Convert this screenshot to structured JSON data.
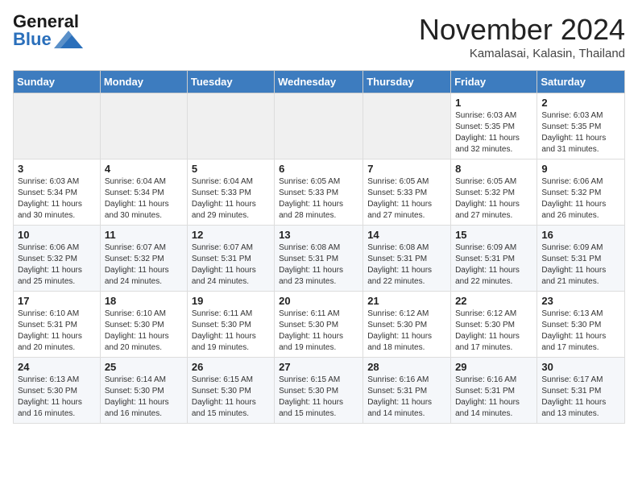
{
  "header": {
    "logo_general": "General",
    "logo_blue": "Blue",
    "month_title": "November 2024",
    "location": "Kamalasai, Kalasin, Thailand"
  },
  "days_of_week": [
    "Sunday",
    "Monday",
    "Tuesday",
    "Wednesday",
    "Thursday",
    "Friday",
    "Saturday"
  ],
  "weeks": [
    [
      {
        "day": "",
        "info": ""
      },
      {
        "day": "",
        "info": ""
      },
      {
        "day": "",
        "info": ""
      },
      {
        "day": "",
        "info": ""
      },
      {
        "day": "",
        "info": ""
      },
      {
        "day": "1",
        "info": "Sunrise: 6:03 AM\nSunset: 5:35 PM\nDaylight: 11 hours and 32 minutes."
      },
      {
        "day": "2",
        "info": "Sunrise: 6:03 AM\nSunset: 5:35 PM\nDaylight: 11 hours and 31 minutes."
      }
    ],
    [
      {
        "day": "3",
        "info": "Sunrise: 6:03 AM\nSunset: 5:34 PM\nDaylight: 11 hours and 30 minutes."
      },
      {
        "day": "4",
        "info": "Sunrise: 6:04 AM\nSunset: 5:34 PM\nDaylight: 11 hours and 30 minutes."
      },
      {
        "day": "5",
        "info": "Sunrise: 6:04 AM\nSunset: 5:33 PM\nDaylight: 11 hours and 29 minutes."
      },
      {
        "day": "6",
        "info": "Sunrise: 6:05 AM\nSunset: 5:33 PM\nDaylight: 11 hours and 28 minutes."
      },
      {
        "day": "7",
        "info": "Sunrise: 6:05 AM\nSunset: 5:33 PM\nDaylight: 11 hours and 27 minutes."
      },
      {
        "day": "8",
        "info": "Sunrise: 6:05 AM\nSunset: 5:32 PM\nDaylight: 11 hours and 27 minutes."
      },
      {
        "day": "9",
        "info": "Sunrise: 6:06 AM\nSunset: 5:32 PM\nDaylight: 11 hours and 26 minutes."
      }
    ],
    [
      {
        "day": "10",
        "info": "Sunrise: 6:06 AM\nSunset: 5:32 PM\nDaylight: 11 hours and 25 minutes."
      },
      {
        "day": "11",
        "info": "Sunrise: 6:07 AM\nSunset: 5:32 PM\nDaylight: 11 hours and 24 minutes."
      },
      {
        "day": "12",
        "info": "Sunrise: 6:07 AM\nSunset: 5:31 PM\nDaylight: 11 hours and 24 minutes."
      },
      {
        "day": "13",
        "info": "Sunrise: 6:08 AM\nSunset: 5:31 PM\nDaylight: 11 hours and 23 minutes."
      },
      {
        "day": "14",
        "info": "Sunrise: 6:08 AM\nSunset: 5:31 PM\nDaylight: 11 hours and 22 minutes."
      },
      {
        "day": "15",
        "info": "Sunrise: 6:09 AM\nSunset: 5:31 PM\nDaylight: 11 hours and 22 minutes."
      },
      {
        "day": "16",
        "info": "Sunrise: 6:09 AM\nSunset: 5:31 PM\nDaylight: 11 hours and 21 minutes."
      }
    ],
    [
      {
        "day": "17",
        "info": "Sunrise: 6:10 AM\nSunset: 5:31 PM\nDaylight: 11 hours and 20 minutes."
      },
      {
        "day": "18",
        "info": "Sunrise: 6:10 AM\nSunset: 5:30 PM\nDaylight: 11 hours and 20 minutes."
      },
      {
        "day": "19",
        "info": "Sunrise: 6:11 AM\nSunset: 5:30 PM\nDaylight: 11 hours and 19 minutes."
      },
      {
        "day": "20",
        "info": "Sunrise: 6:11 AM\nSunset: 5:30 PM\nDaylight: 11 hours and 19 minutes."
      },
      {
        "day": "21",
        "info": "Sunrise: 6:12 AM\nSunset: 5:30 PM\nDaylight: 11 hours and 18 minutes."
      },
      {
        "day": "22",
        "info": "Sunrise: 6:12 AM\nSunset: 5:30 PM\nDaylight: 11 hours and 17 minutes."
      },
      {
        "day": "23",
        "info": "Sunrise: 6:13 AM\nSunset: 5:30 PM\nDaylight: 11 hours and 17 minutes."
      }
    ],
    [
      {
        "day": "24",
        "info": "Sunrise: 6:13 AM\nSunset: 5:30 PM\nDaylight: 11 hours and 16 minutes."
      },
      {
        "day": "25",
        "info": "Sunrise: 6:14 AM\nSunset: 5:30 PM\nDaylight: 11 hours and 16 minutes."
      },
      {
        "day": "26",
        "info": "Sunrise: 6:15 AM\nSunset: 5:30 PM\nDaylight: 11 hours and 15 minutes."
      },
      {
        "day": "27",
        "info": "Sunrise: 6:15 AM\nSunset: 5:30 PM\nDaylight: 11 hours and 15 minutes."
      },
      {
        "day": "28",
        "info": "Sunrise: 6:16 AM\nSunset: 5:31 PM\nDaylight: 11 hours and 14 minutes."
      },
      {
        "day": "29",
        "info": "Sunrise: 6:16 AM\nSunset: 5:31 PM\nDaylight: 11 hours and 14 minutes."
      },
      {
        "day": "30",
        "info": "Sunrise: 6:17 AM\nSunset: 5:31 PM\nDaylight: 11 hours and 13 minutes."
      }
    ]
  ]
}
